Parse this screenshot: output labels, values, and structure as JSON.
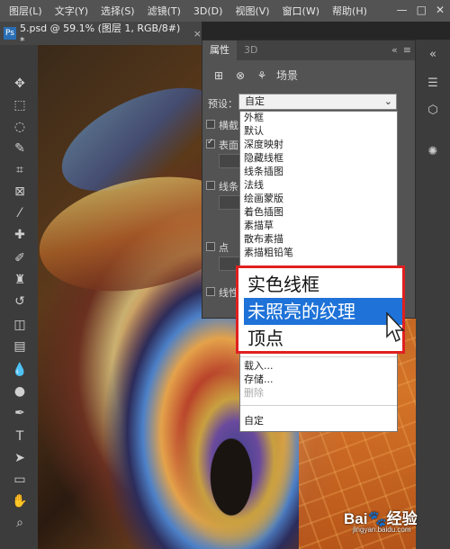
{
  "menu": [
    "图层(L)",
    "文字(Y)",
    "选择(S)",
    "滤镜(T)",
    "3D(D)",
    "视图(V)",
    "窗口(W)",
    "帮助(H)"
  ],
  "window_controls": [
    "—",
    "□",
    "✕"
  ],
  "document_tab": {
    "app_badge": "Ps",
    "title": "5.psd @ 59.1% (图层 1, RGB/8#) *",
    "close": "×"
  },
  "panel": {
    "tabs": [
      "属性",
      "3D"
    ],
    "header_icons": [
      "«",
      "≡"
    ],
    "scene_label": "场景",
    "preset_label": "预设：",
    "preset_value": "自定",
    "checkbox_labels": [
      "横截",
      "表面",
      "线条",
      "点",
      "线性"
    ]
  },
  "dropdown": {
    "items": [
      "外框",
      "默认",
      "深度映射",
      "隐藏线框",
      "线条插图",
      "法线",
      "绘画蒙版",
      "着色插图",
      "素描草",
      "散布素描",
      "素描粗铅笔"
    ],
    "actions": [
      "载入...",
      "存储...",
      "删除"
    ],
    "footer": "自定"
  },
  "zoom_callout": {
    "items": [
      "实色线框",
      "未照亮的纹理",
      "顶点"
    ],
    "selected_index": 1
  },
  "watermark": {
    "brand": "Bai",
    "brand2": "经验",
    "sub": "jingyan.baidu.com"
  },
  "colors": {
    "selection": "#1e72d8",
    "highlight_border": "#e02020",
    "menubar": "#535353"
  }
}
